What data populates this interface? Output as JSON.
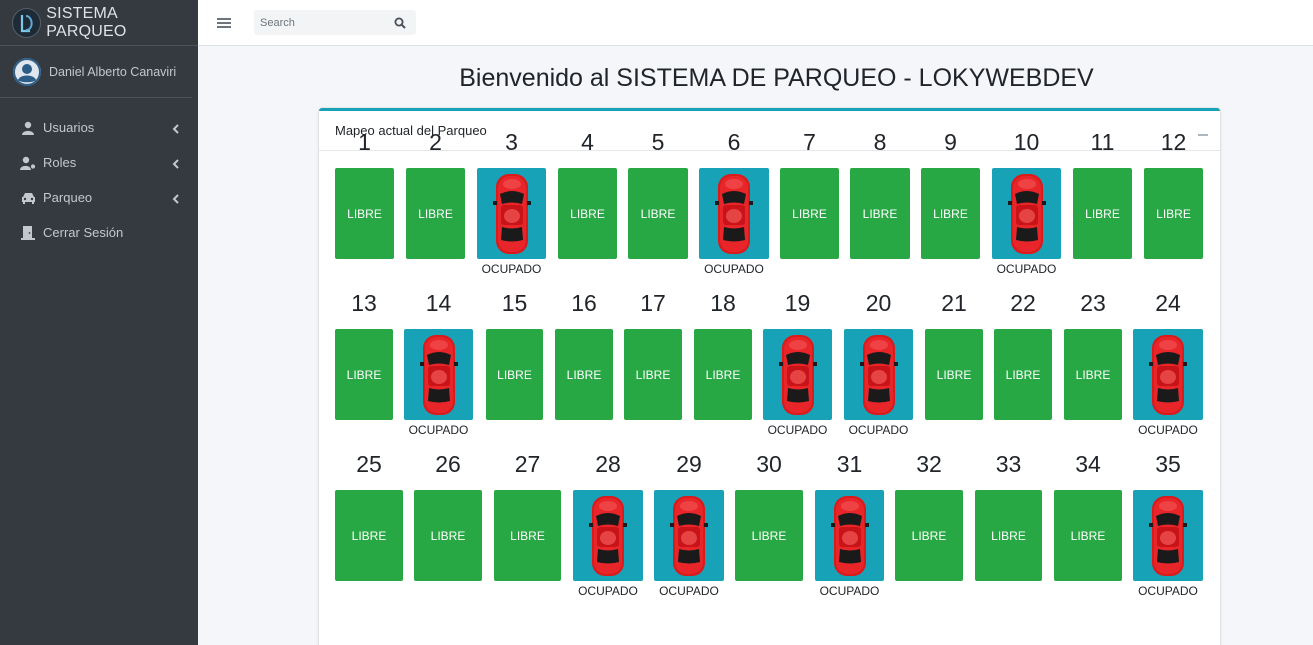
{
  "brand": {
    "name": "SISTEMA PARQUEO"
  },
  "user": {
    "name": "Daniel Alberto Canaviri"
  },
  "sidebar": {
    "items": [
      {
        "label": "Usuarios",
        "icon": "user-icon"
      },
      {
        "label": "Roles",
        "icon": "user-cog-icon"
      },
      {
        "label": "Parqueo",
        "icon": "car-icon"
      },
      {
        "label": "Cerrar Sesión",
        "icon": "door-icon"
      }
    ]
  },
  "topbar": {
    "search_placeholder": "Search"
  },
  "page": {
    "title": "Bienvenido al SISTEMA DE PARQUEO - LOKYWEBDEV"
  },
  "card": {
    "title": "Mapeo actual del Parqueo"
  },
  "status_labels": {
    "free": "LIBRE",
    "occupied": "OCUPADO"
  },
  "colors": {
    "free": "#28a745",
    "occupied": "#17a2b8",
    "accent": "#17a2b8",
    "sidebar": "#343a40"
  },
  "spots": [
    {
      "number": "1",
      "occupied": false
    },
    {
      "number": "2",
      "occupied": false
    },
    {
      "number": "3",
      "occupied": true
    },
    {
      "number": "4",
      "occupied": false
    },
    {
      "number": "5",
      "occupied": false
    },
    {
      "number": "6",
      "occupied": true
    },
    {
      "number": "7",
      "occupied": false
    },
    {
      "number": "8",
      "occupied": false
    },
    {
      "number": "9",
      "occupied": false
    },
    {
      "number": "10",
      "occupied": true
    },
    {
      "number": "11",
      "occupied": false
    },
    {
      "number": "12",
      "occupied": false
    },
    {
      "number": "13",
      "occupied": false
    },
    {
      "number": "14",
      "occupied": true
    },
    {
      "number": "15",
      "occupied": false
    },
    {
      "number": "16",
      "occupied": false
    },
    {
      "number": "17",
      "occupied": false
    },
    {
      "number": "18",
      "occupied": false
    },
    {
      "number": "19",
      "occupied": true
    },
    {
      "number": "20",
      "occupied": true
    },
    {
      "number": "21",
      "occupied": false
    },
    {
      "number": "22",
      "occupied": false
    },
    {
      "number": "23",
      "occupied": false
    },
    {
      "number": "24",
      "occupied": true
    },
    {
      "number": "25",
      "occupied": false
    },
    {
      "number": "26",
      "occupied": false
    },
    {
      "number": "27",
      "occupied": false
    },
    {
      "number": "28",
      "occupied": true
    },
    {
      "number": "29",
      "occupied": true
    },
    {
      "number": "30",
      "occupied": false
    },
    {
      "number": "31",
      "occupied": true
    },
    {
      "number": "32",
      "occupied": false
    },
    {
      "number": "33",
      "occupied": false
    },
    {
      "number": "34",
      "occupied": false
    },
    {
      "number": "35",
      "occupied": true
    }
  ]
}
